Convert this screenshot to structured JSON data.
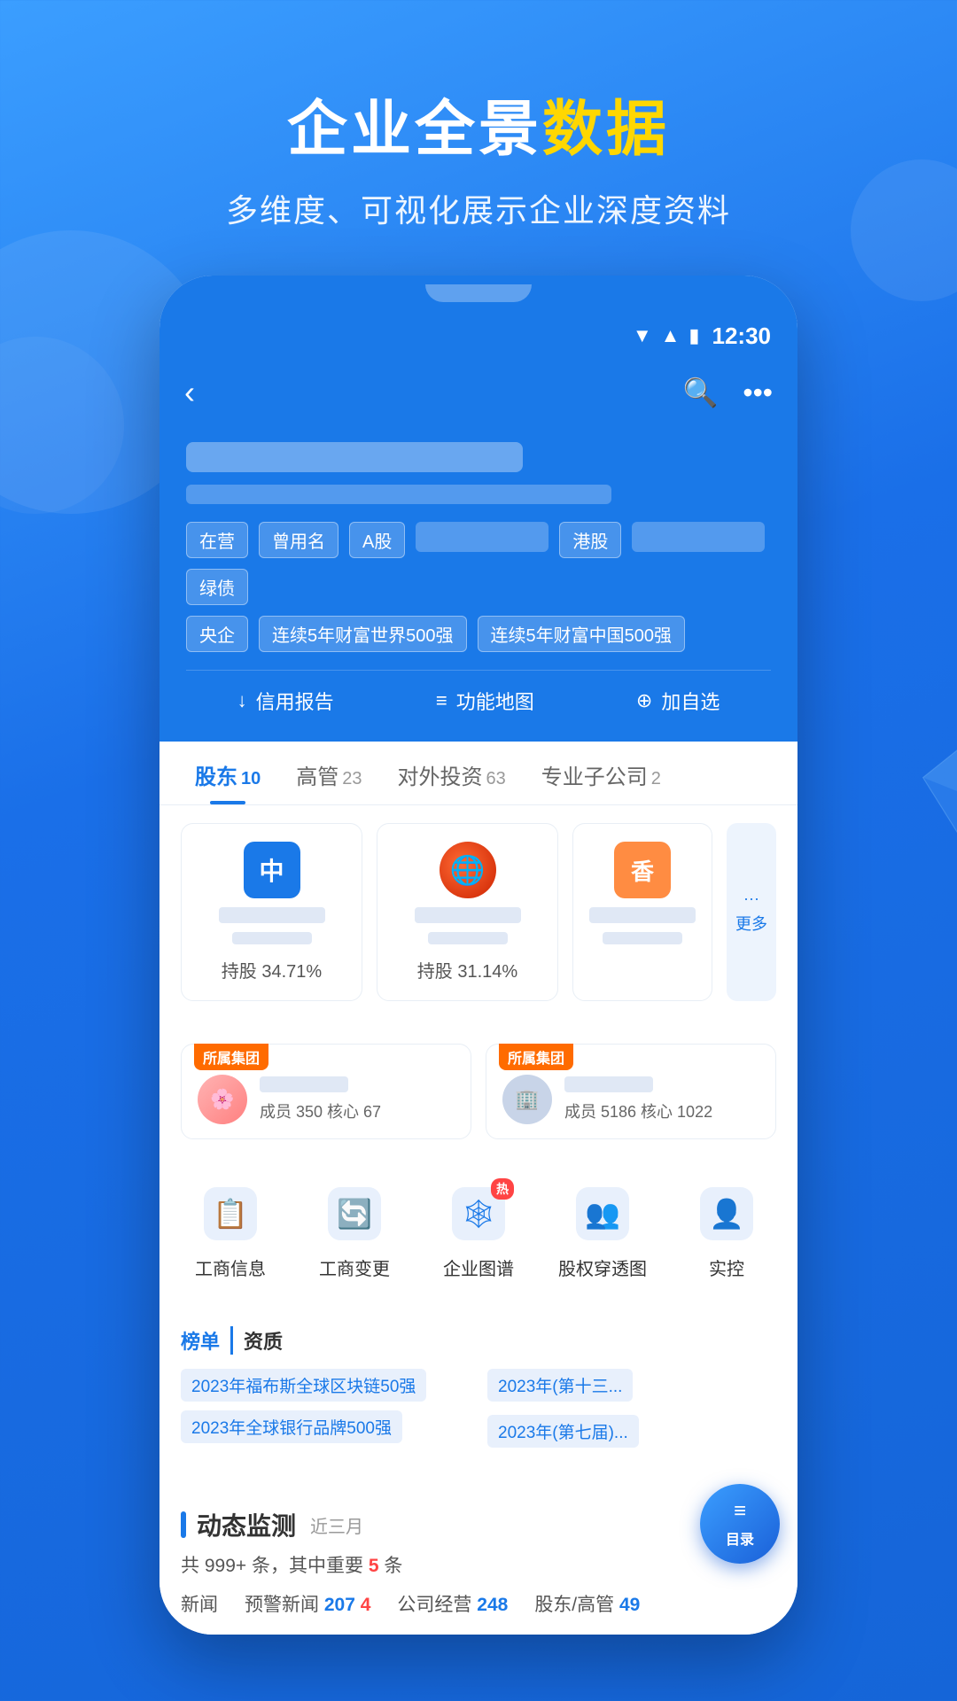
{
  "app": {
    "title_part1": "企业全景",
    "title_part2": "数据",
    "subtitle": "多维度、可视化展示企业深度资料"
  },
  "status_bar": {
    "time": "12:30"
  },
  "nav": {
    "back": "‹",
    "search": "⌕",
    "more": "···"
  },
  "company": {
    "tags_row1": [
      "在营",
      "曾用名",
      "A股",
      "港股",
      "绿债"
    ],
    "tag_blurred_1": "",
    "tag_blurred_2": "",
    "tags_row2": [
      "央企",
      "连续5年财富世界500强",
      "连续5年财富中国500强"
    ],
    "actions": {
      "credit_report": "信用报告",
      "feature_map": "功能地图",
      "add_watchlist": "加自选"
    }
  },
  "tabs": [
    {
      "label": "股东",
      "count": "10",
      "active": true
    },
    {
      "label": "高管",
      "count": "23",
      "active": false
    },
    {
      "label": "对外投资",
      "count": "63",
      "active": false
    },
    {
      "label": "专业子公司",
      "count": "2",
      "active": false
    }
  ],
  "shareholders": {
    "card1": {
      "avatar_text": "中",
      "percent": "持股 34.71%"
    },
    "card2": {
      "percent": "持股 31.14%"
    },
    "card3": {
      "avatar_text": "香",
      "more": "更多"
    }
  },
  "groups": [
    {
      "badge": "所属集团",
      "stats": "成员 350  核心 67"
    },
    {
      "badge": "所属集团",
      "stats": "成员 5186  核心 1022"
    }
  ],
  "features": [
    {
      "label": "工商信息",
      "icon": "📋",
      "hot": false
    },
    {
      "label": "工商变更",
      "icon": "🔄",
      "hot": false
    },
    {
      "label": "企业图谱",
      "icon": "🕸",
      "hot": true
    },
    {
      "label": "股权穿透图",
      "icon": "👥",
      "hot": false
    },
    {
      "label": "实控",
      "icon": "👤",
      "hot": false
    }
  ],
  "rankings": {
    "section_title": "榜单资质",
    "items": [
      "2023年福布斯全球区块链50强",
      "2023年(第十三...",
      "2023年全球银行品牌500强",
      "2023年(第七届)..."
    ]
  },
  "dynamic": {
    "title": "动态监测",
    "period": "近三月",
    "summary_prefix": "共 999+ 条，其中重要",
    "summary_count": "5",
    "summary_suffix": "条",
    "stats": [
      {
        "label": "新闻",
        "value": ""
      },
      {
        "label": "预警新闻",
        "value": "207",
        "extra": "4",
        "extra_color": "red"
      },
      {
        "label": "公司经营",
        "value": "248"
      },
      {
        "label": "股东/高管",
        "value": "49"
      }
    ]
  },
  "float_button": {
    "label": "目录"
  }
}
